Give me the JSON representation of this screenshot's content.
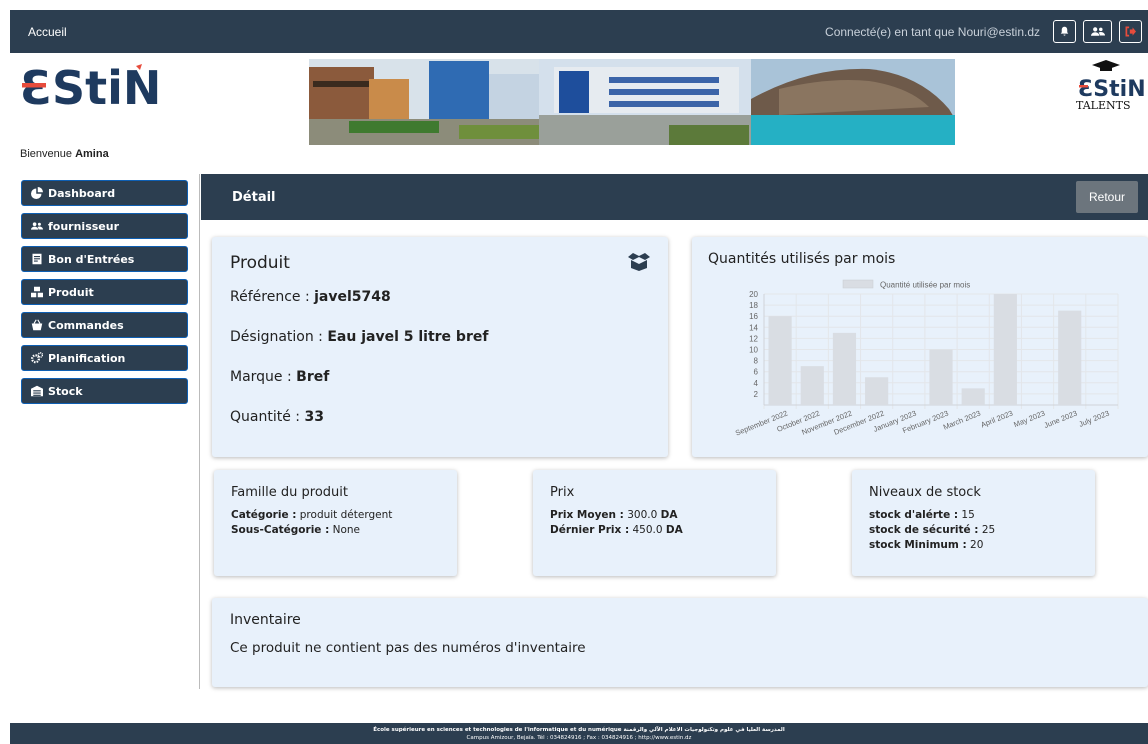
{
  "topbar": {
    "home_label": "Accueil",
    "user_label": "Connecté(e) en tant que Nouri@estin.dz",
    "icons": [
      "bell-icon",
      "users-icon",
      "logout-icon"
    ],
    "logout_color": "#e74c3c"
  },
  "header": {
    "logo_text": "ƐStiN",
    "talents_logo_text": "ƐStiN",
    "talents_sub": "TALENTS",
    "welcome_prefix": "Bienvenue",
    "welcome_name": "Amina"
  },
  "sidebar": {
    "items": [
      {
        "label": "Dashboard",
        "icon": "pie-chart-icon"
      },
      {
        "label": "fournisseur",
        "icon": "users-icon"
      },
      {
        "label": "Bon d'Entrées",
        "icon": "receipt-icon"
      },
      {
        "label": "Produit",
        "icon": "boxes-icon"
      },
      {
        "label": "Commandes",
        "icon": "basket-icon"
      },
      {
        "label": "Planification",
        "icon": "cogs-icon"
      },
      {
        "label": "Stock",
        "icon": "warehouse-icon"
      }
    ]
  },
  "detail": {
    "title": "Détail",
    "back_label": "Retour"
  },
  "product": {
    "title": "Produit",
    "ref_label": "Référence :",
    "ref_value": "javel5748",
    "des_label": "Désignation :",
    "des_value": "Eau javel 5 litre bref",
    "brand_label": "Marque :",
    "brand_value": "Bref",
    "qty_label": "Quantité :",
    "qty_value": "33"
  },
  "chart_data": {
    "type": "bar",
    "title": "Quantités utilisés par mois",
    "legend": "Quantité utilisée par mois",
    "categories": [
      "September 2022",
      "October 2022",
      "November 2022",
      "December 2022",
      "January 2023",
      "February 2023",
      "March 2023",
      "April 2023",
      "May 2023",
      "June 2023",
      "July 2023"
    ],
    "values": [
      16,
      7,
      13,
      5,
      0,
      10,
      3,
      20,
      0,
      17,
      0
    ],
    "ylim": [
      0,
      20
    ],
    "yticks": [
      "2",
      "4",
      "6",
      "8",
      "10",
      "12",
      "14",
      "16",
      "18",
      "20"
    ],
    "bar_color": "#d9dde3",
    "grid": true,
    "legend_position": "top"
  },
  "famille": {
    "title": "Famille du produit",
    "cat_label": "Catégorie :",
    "cat_value": "produit détergent",
    "subcat_label": "Sous-Catégorie :",
    "subcat_value": "None"
  },
  "prix": {
    "title": "Prix",
    "avg_label": "Prix Moyen :",
    "avg_value": "300.0",
    "avg_unit": "DA",
    "last_label": "Dérnier Prix :",
    "last_value": "450.0",
    "last_unit": "DA"
  },
  "stock": {
    "title": "Niveaux de stock",
    "alert_label": "stock d'alérte :",
    "alert_value": "15",
    "security_label": "stock de sécurité :",
    "security_value": "25",
    "min_label": "stock Minimum :",
    "min_value": "20"
  },
  "inventaire": {
    "title": "Inventaire",
    "message": "Ce produit ne contient pas des numéros d'inventaire"
  },
  "footer": {
    "line1": "École supérieure en sciences et technologies de l'informatique et du numérique المدرسة العليا في علوم وتكنولوجيات الاعلام الآلي والرقمنة",
    "line2": "Campus Amizour, Bejaïa. Tél : 034824916 ; Fax : 034824916 ; http://www.estin.dz"
  }
}
